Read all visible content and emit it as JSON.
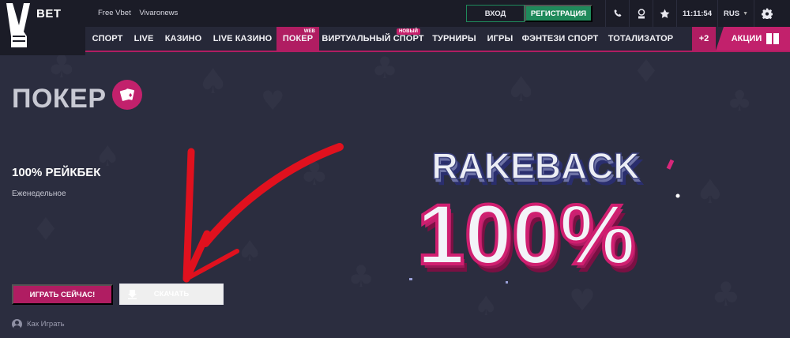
{
  "brand": {
    "logo_text": "BET"
  },
  "topbar": {
    "links": [
      "Free Vbet",
      "Vivaronews"
    ],
    "login_label": "ВХОД",
    "register_label": "РЕГИСТРАЦИЯ",
    "time": "11:11:54",
    "language": "RUS"
  },
  "nav": {
    "items": [
      {
        "label": "СПОРТ"
      },
      {
        "label": "LIVE"
      },
      {
        "label": "КАЗИНО"
      },
      {
        "label": "LIVE КАЗИНО"
      },
      {
        "label": "ПОКЕР",
        "badge": "WEB",
        "active": true
      },
      {
        "label": "ВИРТУАЛЬНЫЙ СПОРТ",
        "badge": "НОВЫЙ"
      },
      {
        "label": "ТУРНИРЫ"
      },
      {
        "label": "ИГРЫ"
      },
      {
        "label": "ФЭНТЕЗИ СПОРТ"
      },
      {
        "label": "ТОТАЛИЗАТОР"
      }
    ],
    "more_label": "+2",
    "promo_label": "АКЦИИ"
  },
  "hero": {
    "page_title": "ПОКЕР",
    "promo_title": "100% РЕЙКБЕК",
    "promo_subtitle": "Еженедельное",
    "play_label": "ИГРАТЬ СЕЙЧАС!",
    "download_label": "СКАЧАТЬ",
    "howto_label": "Как Играть",
    "banner_line1": "RAKEBACK",
    "banner_line2": "100%"
  },
  "colors": {
    "background": "#2b2d3f",
    "topbar": "#1b1c27",
    "accent": "#b01d62",
    "green": "#1f8a5b"
  },
  "icons": [
    "phone-icon",
    "support-icon",
    "star-icon",
    "gear-icon",
    "cards-icon",
    "download-icon",
    "user-icon",
    "gift-icon"
  ]
}
